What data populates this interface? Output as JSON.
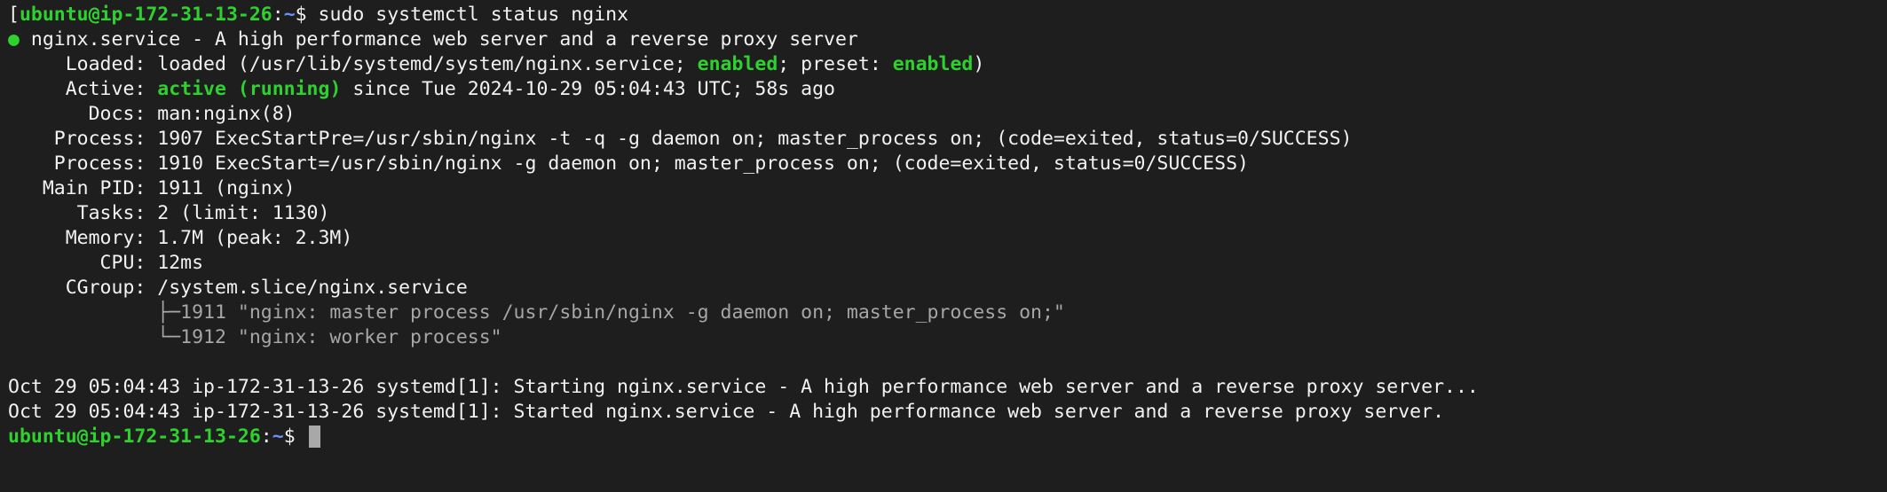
{
  "prompt": {
    "open_bracket": "[",
    "user_host": "ubuntu@ip-172-31-13-26",
    "colon": ":",
    "path": "~",
    "symbol": "$",
    "command": " sudo systemctl status nginx"
  },
  "status": {
    "dot": "●",
    "title": " nginx.service - A high performance web server and a reverse proxy server",
    "loaded_label": "     Loaded: ",
    "loaded_pre": "loaded (/usr/lib/systemd/system/nginx.service; ",
    "loaded_enabled": "enabled",
    "loaded_mid": "; preset: ",
    "loaded_preset": "enabled",
    "loaded_end": ")",
    "active_label": "     Active: ",
    "active_state": "active (running)",
    "active_since": " since Tue 2024-10-29 05:04:43 UTC; 58s ago",
    "docs": "       Docs: man:nginx(8)",
    "process1": "    Process: 1907 ExecStartPre=/usr/sbin/nginx -t -q -g daemon on; master_process on; (code=exited, status=0/SUCCESS)",
    "process2": "    Process: 1910 ExecStart=/usr/sbin/nginx -g daemon on; master_process on; (code=exited, status=0/SUCCESS)",
    "main_pid": "   Main PID: 1911 (nginx)",
    "tasks": "      Tasks: 2 (limit: 1130)",
    "memory": "     Memory: 1.7M (peak: 2.3M)",
    "cpu": "        CPU: 12ms",
    "cgroup": "     CGroup: /system.slice/nginx.service",
    "tree1": "             ├─1911 \"nginx: master process /usr/sbin/nginx -g daemon on; master_process on;\"",
    "tree2": "             └─1912 \"nginx: worker process\""
  },
  "logs": [
    "Oct 29 05:04:43 ip-172-31-13-26 systemd[1]: Starting nginx.service - A high performance web server and a reverse proxy server...",
    "Oct 29 05:04:43 ip-172-31-13-26 systemd[1]: Started nginx.service - A high performance web server and a reverse proxy server."
  ],
  "prompt2": {
    "user_host": "ubuntu@ip-172-31-13-26",
    "colon": ":",
    "path": "~",
    "symbol": "$ "
  },
  "colors": {
    "background": "#1e1e1e",
    "foreground": "#f2f2f2",
    "green": "#2fd12f",
    "blue": "#6f8fff",
    "dim": "#bfbfbf"
  }
}
